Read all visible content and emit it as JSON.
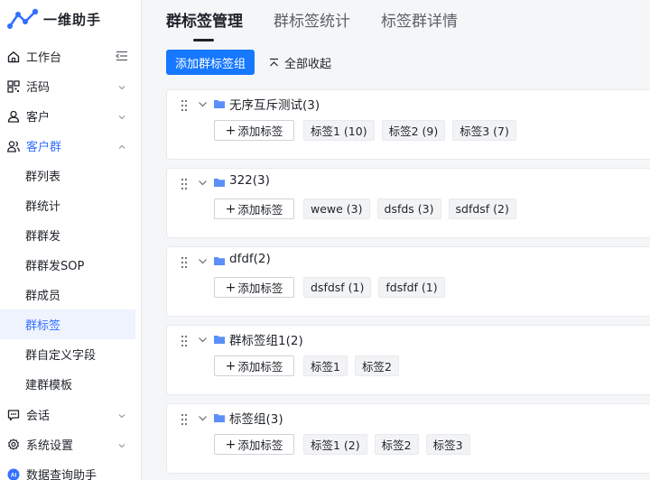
{
  "brand": {
    "name": "一维助手"
  },
  "sidebar": {
    "items": [
      {
        "label": "工作台",
        "icon": "home-icon",
        "caret": "collapse-left-icon"
      },
      {
        "label": "活码",
        "icon": "qrcode-icon",
        "caret": "chevron-down-icon"
      },
      {
        "label": "客户",
        "icon": "user-icon",
        "caret": "chevron-down-icon"
      },
      {
        "label": "客户群",
        "icon": "group-icon",
        "caret": "chevron-up-icon"
      },
      {
        "label": "会话",
        "icon": "chat-icon",
        "caret": "chevron-down-icon"
      },
      {
        "label": "系统设置",
        "icon": "gear-icon",
        "caret": "chevron-down-icon"
      },
      {
        "label": "数据查询助手",
        "icon": "ai-icon",
        "caret": ""
      }
    ],
    "sub_items": [
      {
        "label": "群列表",
        "active": false
      },
      {
        "label": "群统计",
        "active": false
      },
      {
        "label": "群群发",
        "active": false
      },
      {
        "label": "群群发SOP",
        "active": false
      },
      {
        "label": "群成员",
        "active": false
      },
      {
        "label": "群标签",
        "active": true
      },
      {
        "label": "群自定义字段",
        "active": false
      },
      {
        "label": "建群模板",
        "active": false
      }
    ]
  },
  "tabs": [
    {
      "label": "群标签管理",
      "active": true
    },
    {
      "label": "群标签统计",
      "active": false
    },
    {
      "label": "标签群详情",
      "active": false
    }
  ],
  "toolbar": {
    "add_group_label": "添加群标签组",
    "collapse_all_label": "全部收起"
  },
  "groups": [
    {
      "title": "无序互斥测试(3)",
      "add_label": "添加标签",
      "tags": [
        "标签1 (10)",
        "标签2 (9)",
        "标签3 (7)"
      ]
    },
    {
      "title": "322(3)",
      "add_label": "添加标签",
      "tags": [
        "wewe (3)",
        "dsfds (3)",
        "sdfdsf (2)"
      ]
    },
    {
      "title": "dfdf(2)",
      "add_label": "添加标签",
      "tags": [
        "dsfdsf (1)",
        "fdsfdf (1)"
      ]
    },
    {
      "title": "群标签组1(2)",
      "add_label": "添加标签",
      "tags": [
        "标签1",
        "标签2"
      ]
    },
    {
      "title": "标签组(3)",
      "add_label": "添加标签",
      "tags": [
        "标签1 (2)",
        "标签2",
        "标签3"
      ]
    }
  ],
  "colors": {
    "accent": "#1677ff",
    "active_bg": "#eef3fe",
    "active_text": "#3370ff",
    "folder": "#5b8ff9"
  }
}
